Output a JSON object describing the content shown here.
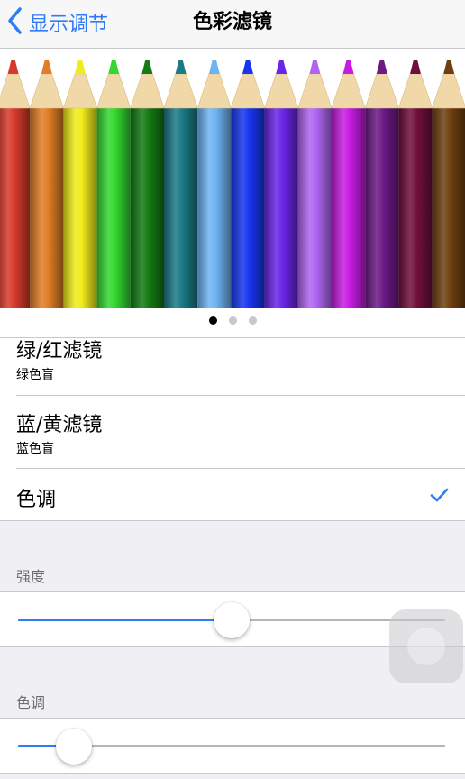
{
  "nav": {
    "back_label": "显示调节",
    "title": "色彩滤镜",
    "back_icon": "chevron-left-icon"
  },
  "pager": {
    "page_count": 3,
    "current_page": 1
  },
  "pencils": {
    "colors": [
      "#d63a2b",
      "#e07d26",
      "#f1ec1b",
      "#33d72f",
      "#147a14",
      "#1a7a86",
      "#6fb4f2",
      "#1735f0",
      "#6a25e6",
      "#b065f2",
      "#c61ce2",
      "#6b1a86",
      "#700f3a",
      "#6e3f10"
    ]
  },
  "filters": [
    {
      "title": "绿/红滤镜",
      "subtitle": "绿色盲",
      "selected": false
    },
    {
      "title": "蓝/黄滤镜",
      "subtitle": "蓝色盲",
      "selected": false
    },
    {
      "title": "色调",
      "subtitle": "",
      "selected": true
    }
  ],
  "sliders": [
    {
      "label": "强度",
      "value": 0.5
    },
    {
      "label": "色调",
      "value": 0.13
    }
  ],
  "accent_color": "#2f7bf6",
  "check_icon": "checkmark-icon"
}
